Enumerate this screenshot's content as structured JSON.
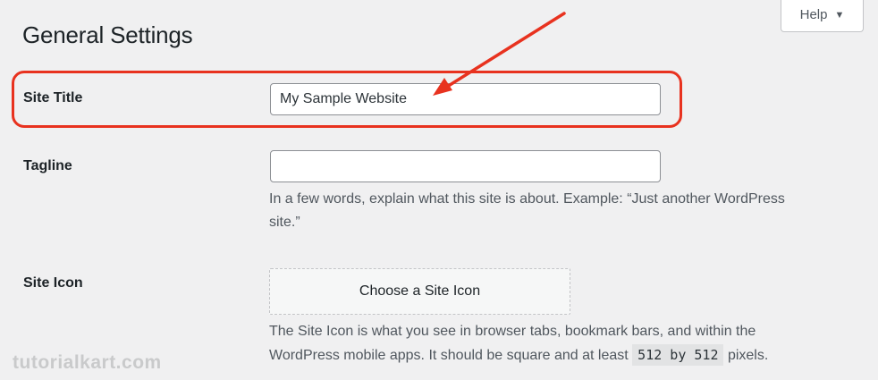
{
  "header": {
    "title": "General Settings",
    "help_label": "Help",
    "help_caret": "▼"
  },
  "settings": {
    "site_title": {
      "label": "Site Title",
      "value": "My Sample Website"
    },
    "tagline": {
      "label": "Tagline",
      "value": "",
      "description_line1": "In a few words, explain what this site is about. Example: “Just another WordPress",
      "description_line2": "site.”"
    },
    "site_icon": {
      "label": "Site Icon",
      "button_label": "Choose a Site Icon",
      "description_line1": "The Site Icon is what you see in browser tabs, bookmark bars, and within the",
      "description_line2_before": "WordPress mobile apps. It should be square and at least",
      "description_code": "512 by 512",
      "description_line2_after": "pixels."
    }
  },
  "annotation": {
    "color": "#e8321f",
    "arrow_icon": "red-arrow-icon"
  },
  "watermark": "tutorialkart.com"
}
